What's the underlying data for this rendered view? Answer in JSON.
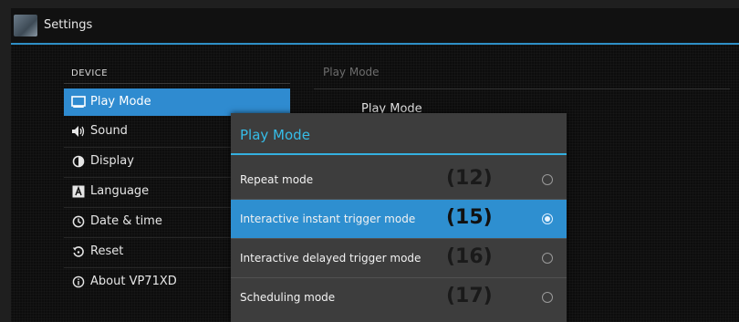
{
  "app": {
    "title": "Settings"
  },
  "sidebar": {
    "category": "DEVICE",
    "items": [
      {
        "label": "Play Mode",
        "icon": "monitor-icon",
        "glyph": "▭"
      },
      {
        "label": "Sound",
        "icon": "speaker-icon",
        "glyph": "🔉"
      },
      {
        "label": "Display",
        "icon": "brightness-icon",
        "glyph": "◐"
      },
      {
        "label": "Language",
        "icon": "language-icon",
        "glyph": "A"
      },
      {
        "label": "Date & time",
        "icon": "clock-icon",
        "glyph": "◷"
      },
      {
        "label": "Reset",
        "icon": "reset-icon",
        "glyph": "↺"
      },
      {
        "label": "About VP71XD",
        "icon": "info-icon",
        "glyph": "ⓘ"
      }
    ]
  },
  "right_panel": {
    "header": "Play Mode",
    "item": "Play Mode"
  },
  "dialog": {
    "title": "Play Mode",
    "options": [
      {
        "label": "Repeat mode",
        "number": "(12)",
        "selected": false
      },
      {
        "label": "Interactive instant trigger mode",
        "number": "(15)",
        "selected": true
      },
      {
        "label": "Interactive delayed trigger mode",
        "number": "(16)",
        "selected": false
      },
      {
        "label": "Scheduling mode",
        "number": "(17)",
        "selected": false
      }
    ]
  },
  "colors": {
    "accent": "#2f8bd0",
    "dialog_title": "#36bde8",
    "dialog_bg": "#3d3d3d"
  }
}
